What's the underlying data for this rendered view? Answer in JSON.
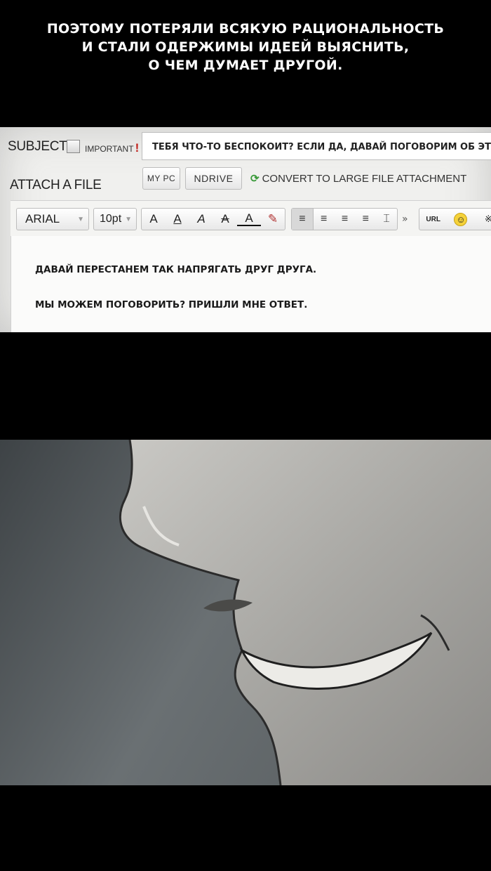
{
  "caption": {
    "line1": "ПОЭТОМУ ПОТЕРЯЛИ ВСЯКУЮ РАЦИОНАЛЬНОСТЬ",
    "line2": "И СТАЛИ ОДЕРЖИМЫ ИДЕЕЙ ВЫЯСНИТЬ,",
    "line3": "О ЧЕМ ДУМАЕТ ДРУГОЙ."
  },
  "compose": {
    "subject_label": "SUBJECT",
    "important_label": "IMPORTANT",
    "important_mark": "!",
    "subject_value": "ТЕБЯ ЧТО-ТО БЕСПОКОИТ? ЕСЛИ ДА, ДАВАЙ ПОГОВОРИМ ОБ ЭТОМ.",
    "attach_label": "ATTACH A FILE",
    "my_pc_button": "MY PC",
    "ndrive_button": "NDRIVE",
    "convert_label": "CONVERT TO LARGE FILE ATTACHMENT",
    "toolbar": {
      "font": "ARIAL",
      "size": "10pt",
      "format_buttons": [
        "A",
        "A",
        "A",
        "A",
        "A",
        "✎"
      ],
      "align_buttons": [
        "≡",
        "≡",
        "≡",
        "≡",
        "⌶"
      ],
      "more": "»",
      "url_button": "URL",
      "smiley": "☺",
      "special": "※"
    },
    "body_lines": [
      "ДАВАЙ ПЕРЕСТАНЕМ ТАК НАПРЯГАТЬ ДРУГ ДРУГА.",
      "МЫ МОЖЕМ ПОГОВОРИТЬ? ПРИШЛИ МНЕ ОТВЕТ."
    ]
  },
  "colors": {
    "background": "#000000",
    "panel": "#f0f0ee",
    "important_mark": "#c0201a",
    "convert_icon": "#3a9a3a"
  }
}
